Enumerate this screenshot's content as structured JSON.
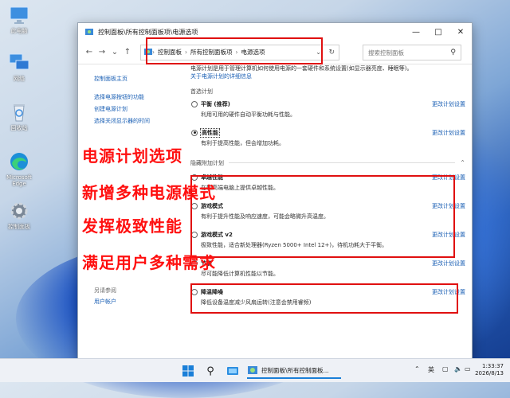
{
  "desktop": {
    "icons": [
      {
        "label": "此电脑"
      },
      {
        "label": "网络"
      },
      {
        "label": "回收站"
      },
      {
        "label": "Microsoft Edge"
      },
      {
        "label": "控制面板"
      }
    ]
  },
  "window": {
    "title": "控制面板\\所有控制面板项\\电源选项",
    "breadcrumb": [
      "控制面板",
      "所有控制面板项",
      "电源选项"
    ],
    "search_placeholder": "搜索控制面板"
  },
  "left_pane": {
    "links": [
      "控制面板主页",
      "选择电源按钮的功能",
      "创建电源计划",
      "选择关闭显示器的时间"
    ],
    "see_also_title": "另请参阅",
    "see_also_links": [
      "用户帐户"
    ]
  },
  "main": {
    "description": "电源计划是用于管理计算机如何使用电源的一套硬件和系统设置(如显示器亮度、睡眠等)。",
    "description_link": "关于电源计划的详细信息",
    "preferred_group": "首选计划",
    "hidden_group": "隐藏附加计划",
    "change_label": "更改计划设置",
    "plans": [
      {
        "name": "平衡 (推荐)",
        "desc": "利用可用的硬件自动平衡功耗与性能。",
        "selected": false
      },
      {
        "name": "高性能",
        "desc": "有利于提高性能，但会增加功耗。",
        "selected": true
      },
      {
        "name": "卓越性能",
        "desc": "在较高端电脑上提供卓越性能。",
        "selected": false
      },
      {
        "name": "游戏模式",
        "desc": "有利于提升性能及响应速度，可能会略微升高温度。",
        "selected": false
      },
      {
        "name": "游戏模式 v2",
        "desc": "极致性能，适合新处理器(Ryzen 5000+ Intel 12+)，待机功耗大于平衡。",
        "selected": false
      },
      {
        "name": "节能",
        "desc": "尽可能降低计算机性能以节能。",
        "selected": false
      },
      {
        "name": "降温降噪",
        "desc": "降低设备温度减少风扇运转(注意会禁用睿频)",
        "selected": false
      }
    ]
  },
  "overlay_lines": [
    "电源计划选项",
    "新增多种电源模式",
    "发挥极致性能",
    "满足用户多种需求"
  ],
  "taskbar": {
    "active_label": "控制面板\\所有控制面板...",
    "ime": "英",
    "time": "1:33:37",
    "date": "2026/8/13"
  },
  "colors": {
    "accent_link": "#1a5fb4",
    "highlight_red": "#e01010"
  }
}
